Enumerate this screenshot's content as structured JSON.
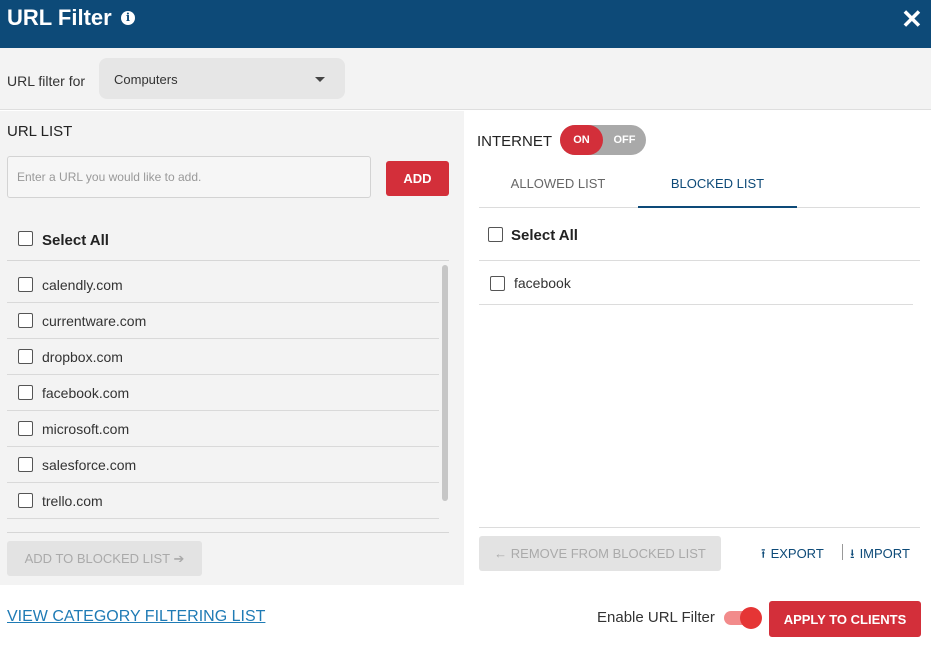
{
  "header": {
    "title": "URL Filter",
    "info_icon": "info-icon",
    "close_icon": "close-icon"
  },
  "filter_bar": {
    "label": "URL filter for",
    "selected": "Computers"
  },
  "url_list": {
    "title": "URL LIST",
    "input_placeholder": "Enter a URL you would like to add.",
    "add_label": "ADD",
    "select_all_label": "Select All",
    "items": [
      "calendly.com",
      "currentware.com",
      "dropbox.com",
      "facebook.com",
      "microsoft.com",
      "salesforce.com",
      "trello.com"
    ],
    "add_to_blocked_label": "ADD TO BLOCKED LIST"
  },
  "internet": {
    "label": "INTERNET",
    "on_label": "ON",
    "off_label": "OFF",
    "state": "on"
  },
  "tabs": {
    "allowed": "ALLOWED LIST",
    "blocked": "BLOCKED LIST",
    "active": "blocked"
  },
  "blocked_list": {
    "select_all_label": "Select All",
    "items": [
      "facebook"
    ],
    "remove_label": "REMOVE FROM BLOCKED LIST",
    "export_label": "EXPORT",
    "import_label": "IMPORT"
  },
  "footer": {
    "category_link": "VIEW CATEGORY FILTERING LIST",
    "enable_label": "Enable URL Filter",
    "enable_state": "on",
    "apply_label": "APPLY TO CLIENTS"
  },
  "colors": {
    "header_bg": "#0d4a78",
    "accent_red": "#d32f3a",
    "link_blue": "#1f7bb5"
  }
}
